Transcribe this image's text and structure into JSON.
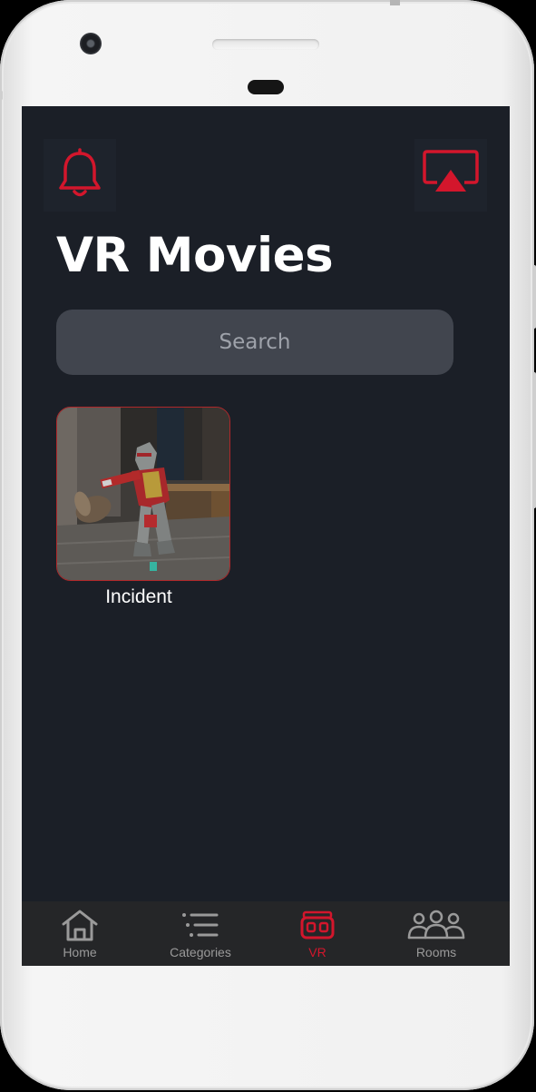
{
  "app": {
    "title": "VR Movies"
  },
  "header": {
    "notification_icon": "bell-icon",
    "cast_icon": "airplay-icon"
  },
  "search": {
    "placeholder": "Search",
    "value": ""
  },
  "movies": [
    {
      "title": "Incident"
    }
  ],
  "bottom_nav": {
    "active": "VR",
    "items": [
      {
        "label": "Home",
        "icon": "home-icon"
      },
      {
        "label": "Categories",
        "icon": "list-icon"
      },
      {
        "label": "VR",
        "icon": "vr-headset-icon"
      },
      {
        "label": "Rooms",
        "icon": "group-icon"
      }
    ]
  },
  "colors": {
    "accent": "#d3162c",
    "background": "#1b1f27",
    "search_bg": "#41454e",
    "nav_bg": "#252628",
    "nav_inactive": "#9a9a9a"
  }
}
